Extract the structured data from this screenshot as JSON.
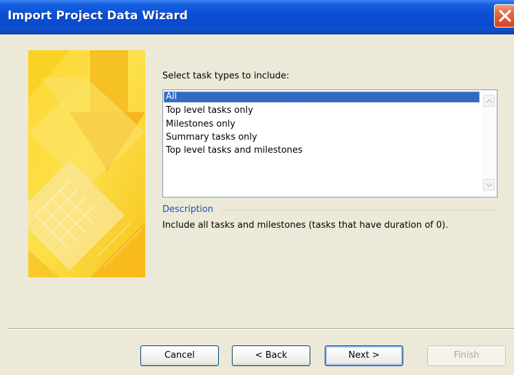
{
  "window": {
    "title": "Import Project Data Wizard"
  },
  "task_types": {
    "prompt": "Select task types to include:",
    "items": [
      "All",
      "Top level tasks only",
      "Milestones only",
      "Summary tasks only",
      "Top level tasks and milestones"
    ],
    "selected": "All"
  },
  "description": {
    "heading": "Description",
    "text": "Include all tasks and milestones (tasks that have duration of 0)."
  },
  "buttons": {
    "cancel": "Cancel",
    "back": "< Back",
    "next": "Next >",
    "finish": "Finish"
  },
  "colors": {
    "titlebar": "#0a4ccf",
    "selection": "#316ac5",
    "dialog_bg": "#ece9d8",
    "description_heading": "#1e4fb5",
    "close_button": "#d6431e"
  },
  "icons": {
    "close": "close-icon",
    "scroll_up": "chevron-up-icon",
    "scroll_down": "chevron-down-icon"
  }
}
